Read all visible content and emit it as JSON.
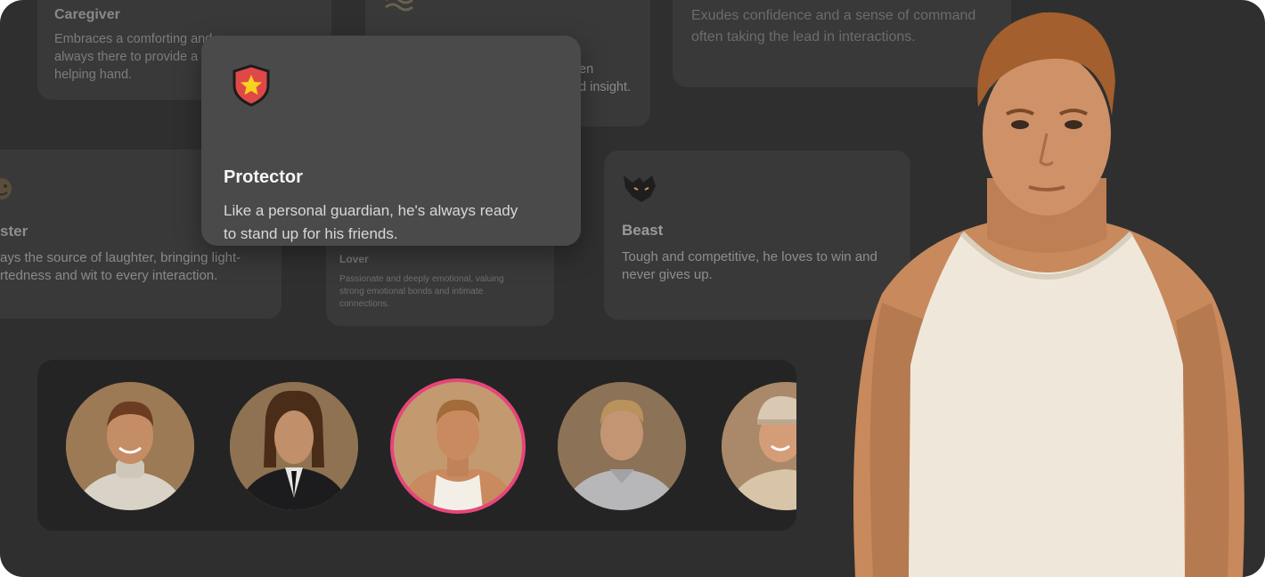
{
  "cards": {
    "caregiver": {
      "title": "Caregiver",
      "desc_line1": "Embraces a comforting and",
      "desc_line2": "always there to provide a",
      "desc_line3": "helping hand."
    },
    "top_center": {
      "desc_line1": "en",
      "desc_line2": "d insight."
    },
    "commander": {
      "desc_line1": "Exudes confidence and a sense of command",
      "desc_line2": "often taking the lead in interactions."
    },
    "jester": {
      "title": "ster",
      "desc_line1": "ays the source of laughter, bringing light-",
      "desc_line2": "rtedness and wit to every interaction."
    },
    "lover": {
      "title": "Lover",
      "desc_line1": "Passionate and deeply emotional, valuing",
      "desc_line2": "strong emotional bonds and intimate",
      "desc_line3": "connections."
    },
    "beast": {
      "title": "Beast",
      "desc_line1": "Tough and competitive, he loves to win and",
      "desc_line2": "never gives up."
    }
  },
  "featured": {
    "icon": "shield-star-icon",
    "title": "Protector",
    "desc_line1": "Like a personal guardian, he's always ready",
    "desc_line2": "to stand up for his friends."
  },
  "avatars": [
    {
      "name": "avatar-turtleneck",
      "selected": false
    },
    {
      "name": "avatar-suit",
      "selected": false
    },
    {
      "name": "avatar-tank-top",
      "selected": true
    },
    {
      "name": "avatar-polo",
      "selected": false
    },
    {
      "name": "avatar-cap",
      "selected": false
    }
  ],
  "colors": {
    "background": "#2f2f2f",
    "card": "#393939",
    "featured_card": "#4a4a4a",
    "selected_ring": "#e8457a",
    "shield": "#e04848",
    "star": "#f7d21f"
  }
}
